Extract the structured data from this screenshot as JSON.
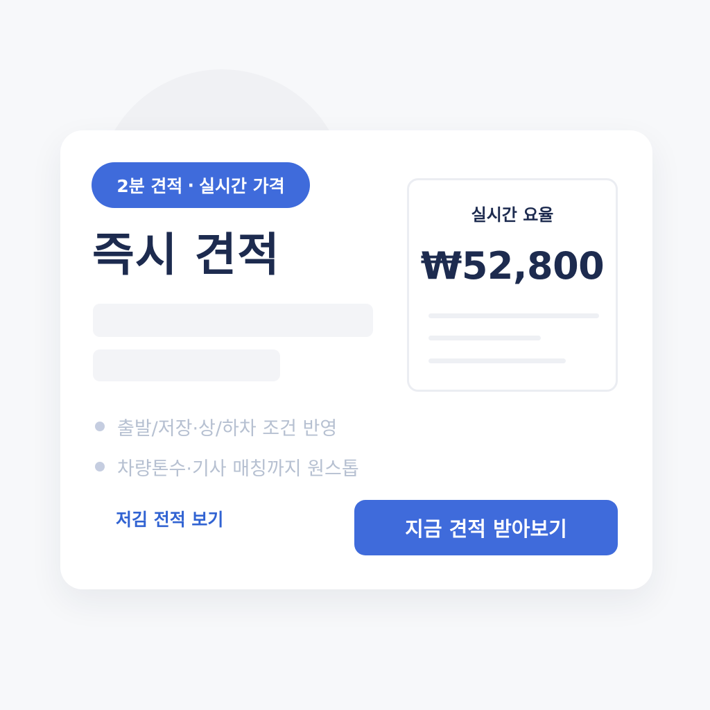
{
  "badge": {
    "part1": "2분 견적",
    "separator": "·",
    "part2": "실시간 가격"
  },
  "title": "즉시 견적",
  "features": [
    "출발/저장·상/하차 조건 반영",
    "차량톤수·기사 매칭까지 원스톱"
  ],
  "secondary_link": "저김 전적 보기",
  "primary_button": "지금 견적 받아보기",
  "price_card": {
    "label": "실시간 요율",
    "value": "₩52,800"
  },
  "colors": {
    "accent": "#3f6bdb",
    "link": "#3163d2",
    "heading": "#1d2b4f",
    "muted_text": "#b6c0d1",
    "background": "#f7f8fa",
    "card": "#ffffff"
  },
  "icons": {
    "feature_bullet": "dot-icon"
  }
}
